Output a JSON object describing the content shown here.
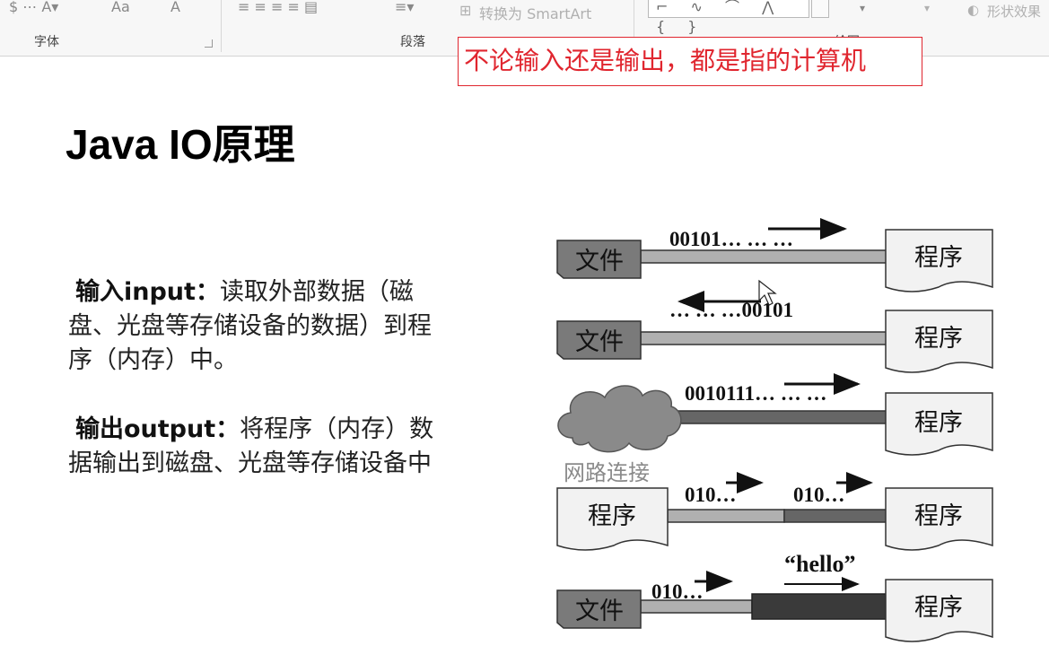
{
  "ribbon": {
    "groups": [
      {
        "label": "字体"
      },
      {
        "label": "段落"
      },
      {
        "label": "绘图"
      }
    ],
    "convert_smartart": "转换为 SmartArt",
    "shape_effects": "形状效果",
    "font_size_label": "Aa",
    "font_color_label": "A"
  },
  "callout": "不论输入还是输出，都是指的计算机",
  "slide": {
    "title": "Java IO原理",
    "input_term": "输入input：",
    "input_desc": "读取外部数据（磁盘、光盘等存储设备的数据）到程序（内存）中。",
    "output_term": "输出output：",
    "output_desc": "将程序（内存）数据输出到磁盘、光盘等存储设备中"
  },
  "diagram": {
    "file_label": "文件",
    "program_label": "程序",
    "network_label": "网路连接",
    "row1_bits": "00101… … …",
    "row2_bits": "… … …00101",
    "row3_bits": "0010111… … …",
    "row4_bits_left": "010…",
    "row4_bits_right": "010…",
    "row5_bits": "010…",
    "row5_hello": "“hello”"
  }
}
